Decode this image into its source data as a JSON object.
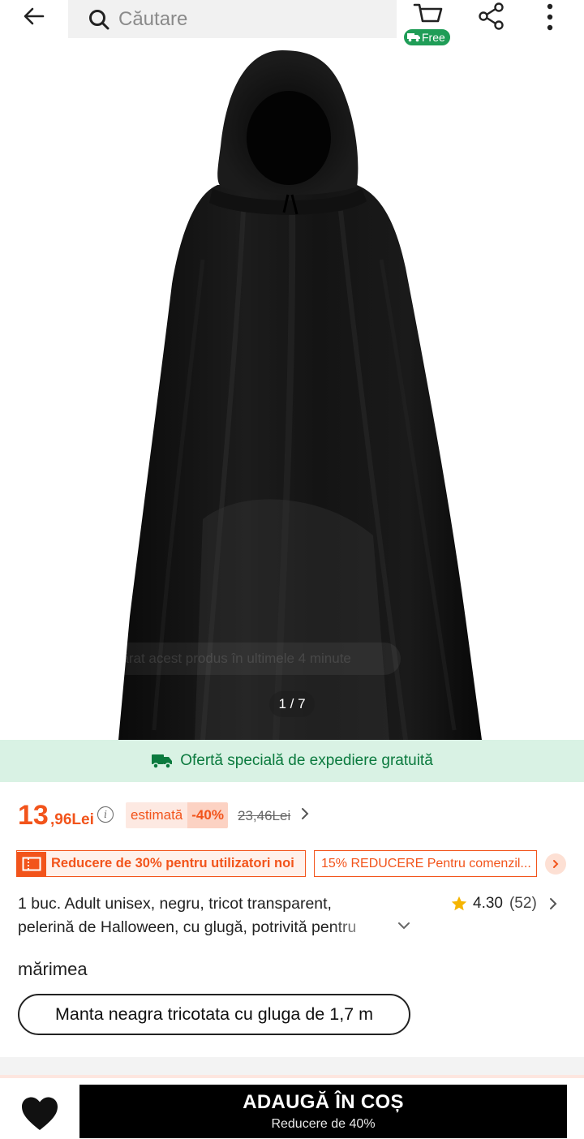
{
  "header": {
    "search_placeholder": "Căutare",
    "cart_badge": "Free",
    "icons": [
      "back-arrow-icon",
      "search-icon",
      "cart-icon",
      "truck-icon",
      "share-icon",
      "more-vertical-icon"
    ]
  },
  "gallery": {
    "toast": "Cineva a cumpărat acest produs în ultimele 4 minute",
    "counter": "1 / 7"
  },
  "shipping": {
    "text": "Ofertă specială de expediere gratuită"
  },
  "price": {
    "integer": "13",
    "decimal": ",96Lei",
    "estimate_label": "estimată",
    "discount": "-40%",
    "original": "23,46Lei",
    "accent_color": "#f2541b"
  },
  "coupons": {
    "new_users": "Reducere de 30% pentru utilizatori noi",
    "order": "15% REDUCERE Pentru comenzil..."
  },
  "product": {
    "title": "1 buc. Adult unisex, negru, tricot transparent, pelerină de Halloween, cu glugă, potrivită pentru",
    "rating": "4.30",
    "reviews": "(52)"
  },
  "size": {
    "label": "mărimea",
    "selected": "Manta neagra tricotata cu gluga de 1,7 m"
  },
  "bottom": {
    "add_to_cart": "ADAUGĂ ÎN COȘ",
    "sub": "Reducere de 40%"
  }
}
